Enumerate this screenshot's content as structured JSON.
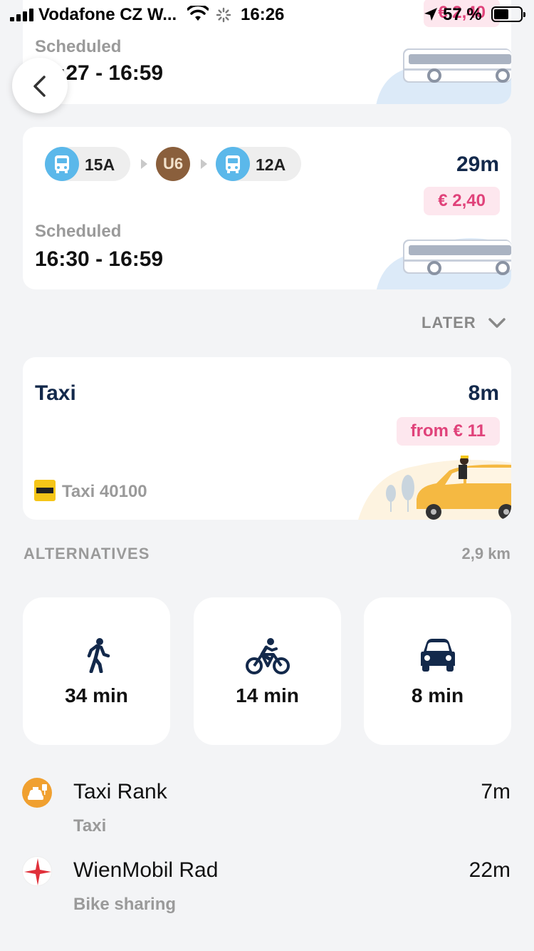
{
  "status_bar": {
    "carrier": "Vodafone CZ W...",
    "time": "16:26",
    "battery_percent": "57 %",
    "battery_level": 0.57
  },
  "routes": [
    {
      "time_range": "16:27 - 16:59",
      "scheduled_label": "Scheduled",
      "price": "€ 2,40"
    },
    {
      "legs": [
        {
          "type": "bus",
          "label": "15A",
          "icon": "bus-icon"
        },
        {
          "type": "subway",
          "label": "U6"
        },
        {
          "type": "bus",
          "label": "12A",
          "icon": "bus-icon"
        }
      ],
      "duration": "29m",
      "price": "€ 2,40",
      "scheduled_label": "Scheduled",
      "time_range": "16:30 - 16:59"
    }
  ],
  "later_button": {
    "label": "LATER",
    "icon": "chevron-down-icon"
  },
  "taxi_card": {
    "title": "Taxi",
    "duration": "8m",
    "price": "from € 11",
    "provider": "Taxi 40100"
  },
  "alternatives": {
    "label": "ALTERNATIVES",
    "distance": "2,9 km",
    "modes": [
      {
        "icon": "walking-icon",
        "duration": "34 min"
      },
      {
        "icon": "bicycle-icon",
        "duration": "14 min"
      },
      {
        "icon": "car-icon",
        "duration": "8 min"
      }
    ]
  },
  "nearby": [
    {
      "icon": "taxi-rank-icon",
      "name": "Taxi Rank",
      "subtitle": "Taxi",
      "time": "7m",
      "color": "#f0a030"
    },
    {
      "icon": "wienmobil-star-icon",
      "name": "WienMobil Rad",
      "subtitle": "Bike sharing",
      "time": "22m",
      "color": "#e0303a"
    }
  ],
  "colors": {
    "background": "#f3f4f6",
    "navy": "#13294b",
    "price_pink": "#e0427a",
    "price_bg": "#fde7ee",
    "bus_blue": "#5bb8ea",
    "u6_brown": "#8a5f3c"
  }
}
